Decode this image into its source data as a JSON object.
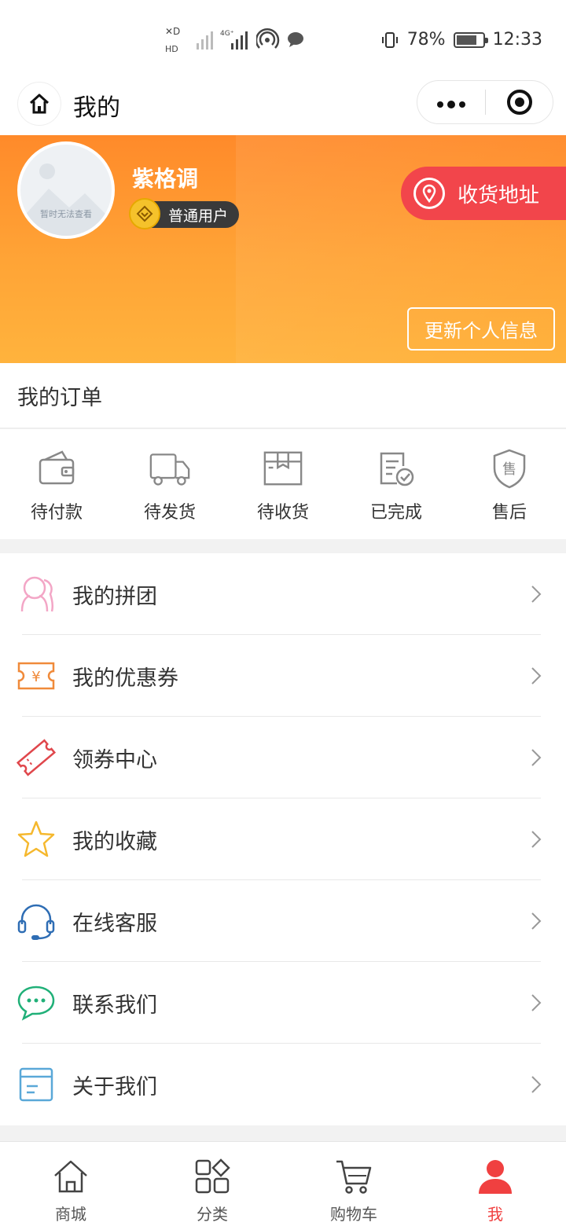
{
  "status_bar": {
    "left_indicators": "HD 4G",
    "battery": "78%",
    "battery_level": 0.78,
    "time": "12:33"
  },
  "header": {
    "title": "我的",
    "home_icon": "home-icon",
    "more_icon": "more-dots-icon",
    "close_icon": "target-icon"
  },
  "profile": {
    "avatar_placeholder": "暂时无法查看",
    "name": "紫格调",
    "member_level": "普通用户",
    "address_button": "收货地址",
    "update_button": "更新个人信息"
  },
  "orders": {
    "title": "我的订单",
    "items": [
      {
        "label": "待付款",
        "icon": "wallet-icon"
      },
      {
        "label": "待发货",
        "icon": "truck-icon"
      },
      {
        "label": "待收货",
        "icon": "package-icon"
      },
      {
        "label": "已完成",
        "icon": "completed-icon"
      },
      {
        "label": "售后",
        "icon": "after-sales-shield-icon"
      }
    ]
  },
  "menu": [
    {
      "label": "我的拼团",
      "icon": "group-buy-icon"
    },
    {
      "label": "我的优惠券",
      "icon": "coupon-icon"
    },
    {
      "label": "领券中心",
      "icon": "ticket-icon"
    },
    {
      "label": "我的收藏",
      "icon": "star-icon"
    },
    {
      "label": "在线客服",
      "icon": "headset-icon"
    },
    {
      "label": "联系我们",
      "icon": "chat-icon"
    },
    {
      "label": "关于我们",
      "icon": "about-card-icon"
    }
  ],
  "tabs": [
    {
      "label": "商城",
      "icon": "home-icon"
    },
    {
      "label": "分类",
      "icon": "category-icon"
    },
    {
      "label": "购物车",
      "icon": "cart-icon"
    },
    {
      "label": "我",
      "icon": "user-icon"
    }
  ],
  "colors": {
    "accent": "#f04040",
    "header_gradient": "#ff8a2a",
    "address_button": "#f2454b"
  }
}
